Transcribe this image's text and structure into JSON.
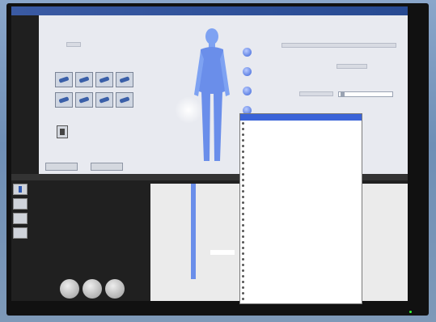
{
  "window": {
    "title": ""
  },
  "upper": {
    "field_labels": [
      "",
      ""
    ],
    "right_labels": [
      "",
      ""
    ]
  },
  "lower": {
    "title": ""
  },
  "dropdown": {
    "selected": "",
    "items": [
      "",
      "",
      "",
      "",
      "",
      "",
      "",
      "",
      "",
      "",
      "",
      "",
      "",
      "",
      "",
      "",
      "",
      "",
      "",
      "",
      "",
      "",
      "",
      "",
      "",
      "",
      "",
      "",
      "",
      "",
      "",
      ""
    ]
  },
  "brand": {
    "text": ""
  },
  "colors": {
    "accent": "#3a63d8",
    "body": "#6a8eea",
    "panel": "#e8eaf0"
  }
}
